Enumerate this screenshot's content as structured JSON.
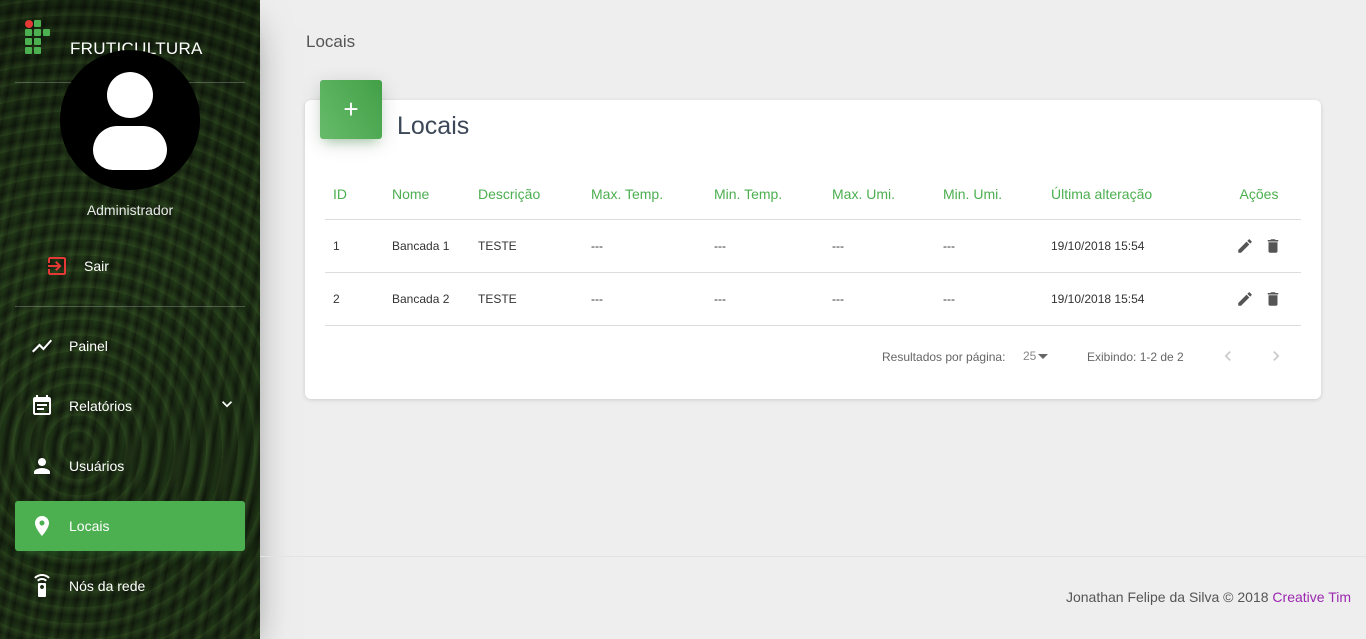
{
  "app": {
    "brand": "FRUTICULTURA"
  },
  "user": {
    "name": "Administrador"
  },
  "logout": {
    "label": "Sair"
  },
  "nav": {
    "items": [
      {
        "label": "Painel",
        "icon": "timeline-icon"
      },
      {
        "label": "Relatórios",
        "icon": "event-note-icon",
        "expandable": true
      },
      {
        "label": "Usuários",
        "icon": "person-icon"
      },
      {
        "label": "Locais",
        "icon": "place-icon",
        "active": true
      },
      {
        "label": "Nós da rede",
        "icon": "settings-remote-icon"
      }
    ]
  },
  "page": {
    "title": "Locais"
  },
  "card": {
    "title": "Locais",
    "add_label": "+",
    "columns": [
      "ID",
      "Nome",
      "Descrição",
      "Max. Temp.",
      "Min. Temp.",
      "Max. Umi.",
      "Min. Umi.",
      "Última alteração",
      "Ações"
    ],
    "rows": [
      {
        "id": "1",
        "nome": "Bancada 1",
        "descricao": "TESTE",
        "max_temp": "---",
        "min_temp": "---",
        "max_umi": "---",
        "min_umi": "---",
        "alteracao": "19/10/2018 15:54"
      },
      {
        "id": "2",
        "nome": "Bancada 2",
        "descricao": "TESTE",
        "max_temp": "---",
        "min_temp": "---",
        "max_umi": "---",
        "min_umi": "---",
        "alteracao": "19/10/2018 15:54"
      }
    ]
  },
  "pagination": {
    "rows_per_page_label": "Resultados por página:",
    "rows_per_page": "25",
    "showing": "Exibindo: 1-2 de 2"
  },
  "footer": {
    "text": "Jonathan Felipe da Silva © 2018",
    "link": "Creative Tim"
  },
  "colors": {
    "accent": "#4caf50",
    "link": "#9c27b0",
    "logout_icon": "#e53935"
  }
}
